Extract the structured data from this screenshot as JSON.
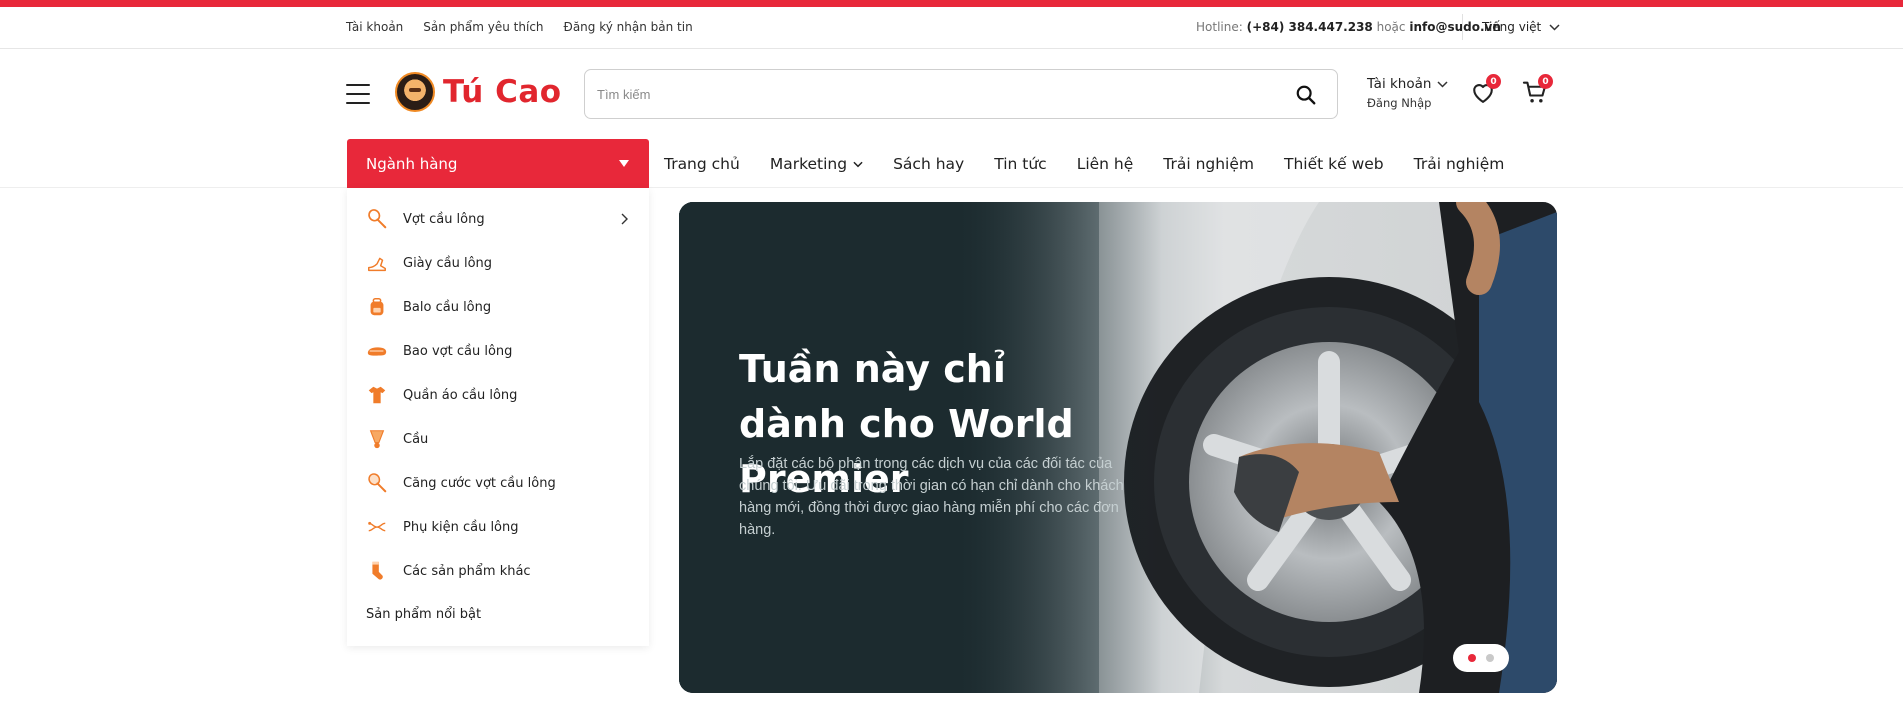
{
  "topbar": {
    "links": [
      "Tài khoản",
      "Sản phẩm yêu thích",
      "Đăng ký nhận bản tin"
    ],
    "hotline_label": "Hotline:",
    "hotline_number": "(+84) 384.447.238",
    "or_label": "hoặc",
    "email": "info@sudo.vn",
    "language": "Tiếng việt"
  },
  "header": {
    "logo_text": "Tú Cao",
    "search_placeholder": "Tìm kiếm",
    "search_value": "",
    "account_title": "Tài khoản",
    "account_login": "Đăng Nhập",
    "wishlist_count": "0",
    "cart_count": "0"
  },
  "nav": {
    "category_label": "Ngành hàng",
    "items": [
      {
        "label": "Trang chủ",
        "has_dropdown": false
      },
      {
        "label": "Marketing",
        "has_dropdown": true
      },
      {
        "label": "Sách hay",
        "has_dropdown": false
      },
      {
        "label": "Tin tức",
        "has_dropdown": false
      },
      {
        "label": "Liên hệ",
        "has_dropdown": false
      },
      {
        "label": "Trải nghiệm",
        "has_dropdown": false
      },
      {
        "label": "Thiết kế web",
        "has_dropdown": false
      },
      {
        "label": "Trải nghiệm",
        "has_dropdown": false
      }
    ]
  },
  "sidebar": {
    "items": [
      {
        "label": "Vợt cầu lông",
        "icon": "racket-icon",
        "has_submenu": true
      },
      {
        "label": "Giày cầu lông",
        "icon": "shoe-icon",
        "has_submenu": false
      },
      {
        "label": "Balo cầu lông",
        "icon": "backpack-icon",
        "has_submenu": false
      },
      {
        "label": "Bao vợt cầu lông",
        "icon": "racket-bag-icon",
        "has_submenu": false
      },
      {
        "label": "Quần áo cầu lông",
        "icon": "clothes-icon",
        "has_submenu": false
      },
      {
        "label": "Cầu",
        "icon": "shuttlecock-icon",
        "has_submenu": false
      },
      {
        "label": "Căng cước vợt cầu lông",
        "icon": "stringing-icon",
        "has_submenu": false
      },
      {
        "label": "Phụ kiện cầu lông",
        "icon": "accessories-icon",
        "has_submenu": false
      },
      {
        "label": "Các sản phẩm khác",
        "icon": "socks-icon",
        "has_submenu": false
      }
    ],
    "featured_label": "Sản phẩm nổi bật"
  },
  "banner": {
    "title": "Tuần này chỉ dành cho World Premier",
    "description": "Lắp đặt các bộ phận trong các dịch vụ của các đối tác của chúng tôi. Ưu đãi trong thời gian có hạn chỉ dành cho khách hàng mới, đồng thời được giao hàng miễn phí cho các đơn hàng.",
    "slides": 2,
    "active_slide": 1
  },
  "colors": {
    "accent": "#e8283a",
    "icon_orange": "#f07c2a",
    "banner_dark": "#1c2b2f"
  }
}
